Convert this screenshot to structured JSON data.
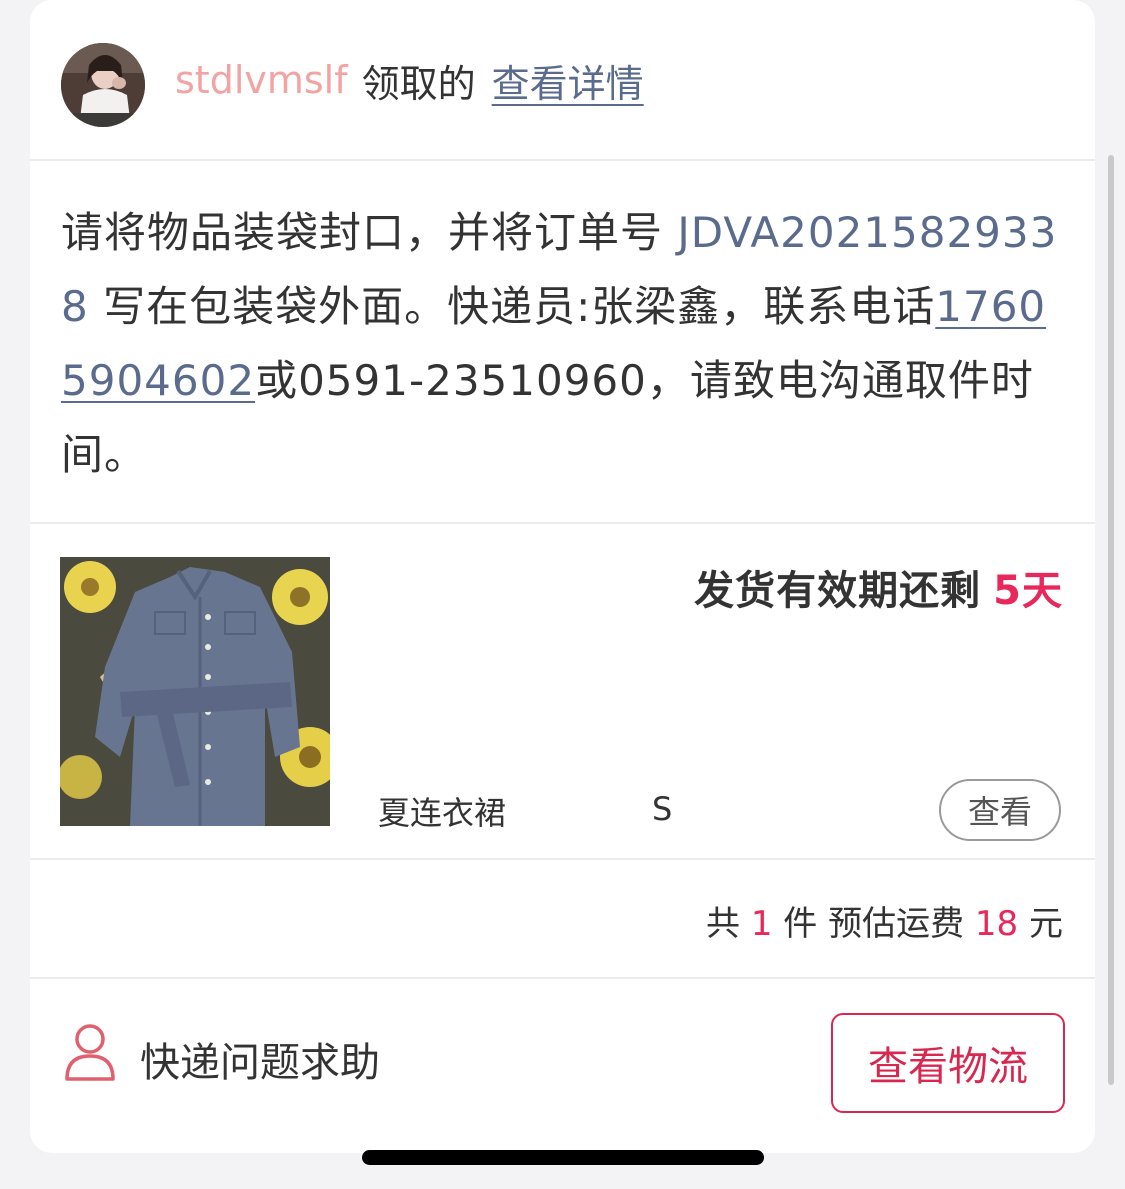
{
  "header": {
    "username": "stdlvmslf",
    "claimed_label": "领取的",
    "details_link": "查看详情"
  },
  "message": {
    "part1": "请将物品装袋封口，并将订单号 ",
    "order_number": "JDVA20215829338",
    "part2": " 写在包装袋外面。快递员:张梁鑫，联系电话",
    "phone": "17605904602",
    "part3": "或0591-23510960，请致电沟通取件时间。"
  },
  "product": {
    "deadline_label": "发货有效期还剩",
    "deadline_days": "5天",
    "name": "夏连衣裙",
    "size": "S",
    "view_button": "查看"
  },
  "summary": {
    "prefix": "共",
    "count": "1",
    "count_unit": "件 预估运费",
    "fee": "18",
    "fee_unit": "元"
  },
  "footer": {
    "help_text": "快递问题求助",
    "logistics_button": "查看物流"
  },
  "colors": {
    "accent": "#e8275a",
    "link": "#5a6b8e",
    "username": "#f2a3a3"
  },
  "icons": {
    "help": "user-icon"
  }
}
